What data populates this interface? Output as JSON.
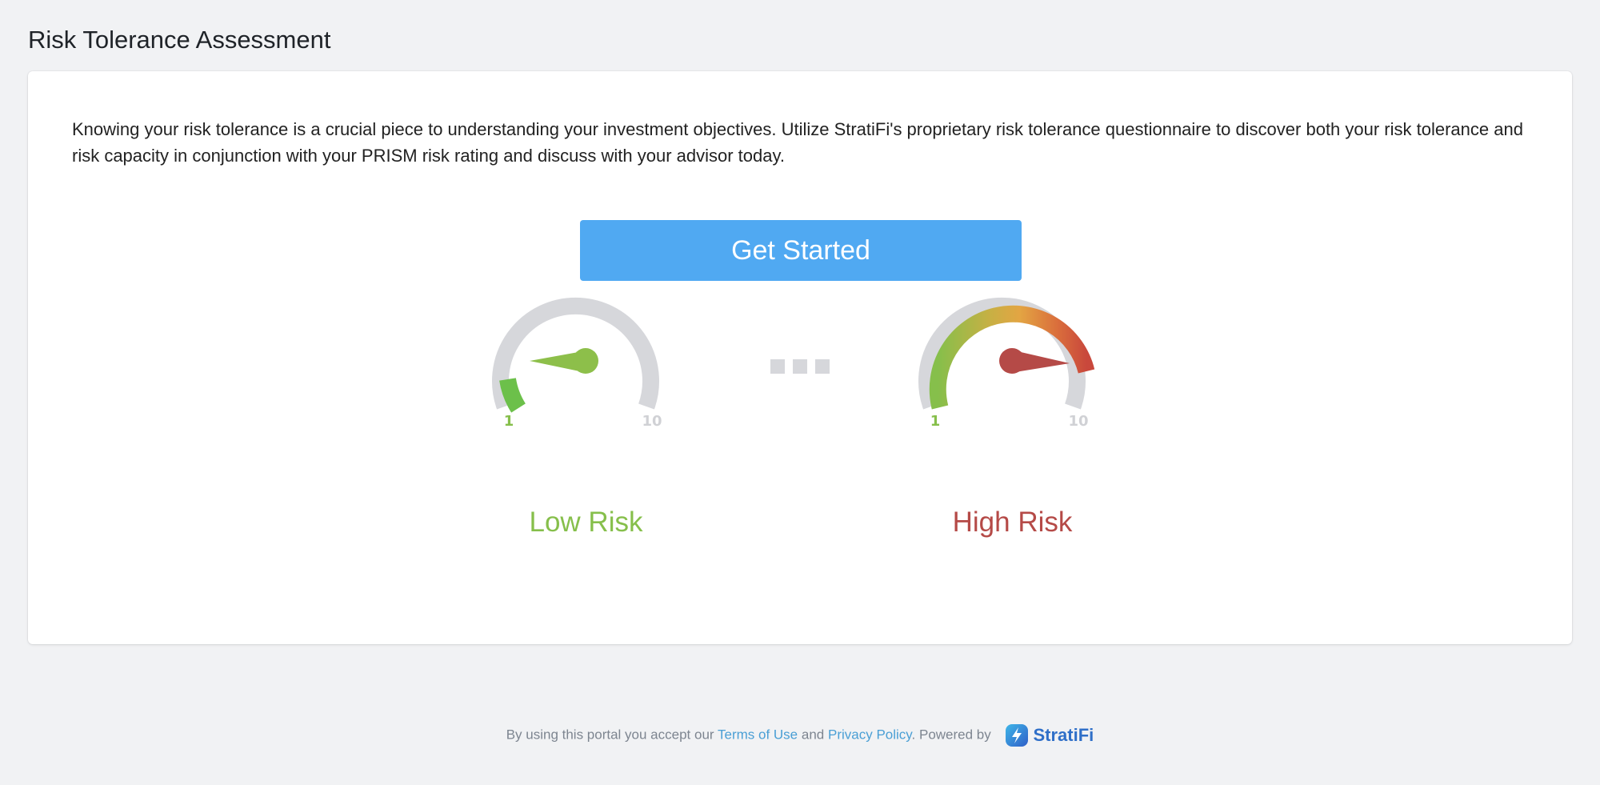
{
  "page": {
    "title": "Risk Tolerance Assessment"
  },
  "card": {
    "intro": "Knowing your risk tolerance is a crucial piece to understanding your investment objectives. Utilize StratiFi's proprietary risk tolerance questionnaire to discover both your risk tolerance and risk capacity in conjunction with your PRISM risk rating and discuss with your advisor today.",
    "cta_label": "Get Started"
  },
  "gauges": {
    "low": {
      "label": "Low Risk",
      "min_label": "1",
      "max_label": "10",
      "value": 1,
      "needle_color": "#8dbf4a"
    },
    "high": {
      "label": "High Risk",
      "min_label": "1",
      "max_label": "10",
      "value": 10,
      "needle_color": "#b54a47"
    }
  },
  "footer": {
    "prefix": "By using this portal you accept our",
    "terms_label": "Terms of Use",
    "and_text": "and",
    "privacy_label": "Privacy Policy",
    "powered_by": ". Powered by",
    "brand": "StratiFi"
  },
  "colors": {
    "accent": "#50a9f2",
    "low": "#86bf4b",
    "high": "#b54a47",
    "track": "#d6d7db",
    "link": "#4a9fd5",
    "brand": "#2f6fc8"
  }
}
